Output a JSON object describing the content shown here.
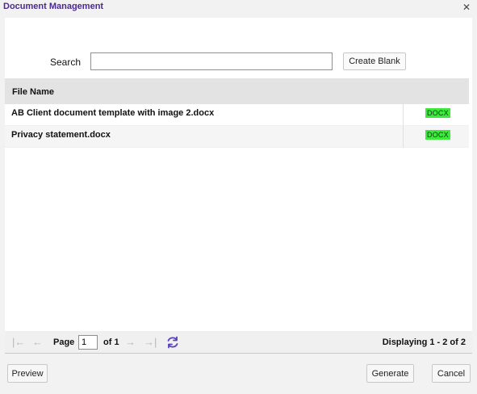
{
  "window": {
    "title": "Document Management",
    "close_glyph": "✕"
  },
  "search": {
    "label": "Search",
    "value": "",
    "placeholder": ""
  },
  "toolbar": {
    "create_blank_label": "Create Blank"
  },
  "grid": {
    "columns": [
      "File Name",
      ""
    ],
    "rows": [
      {
        "name": "AB Client document template with image 2.docx",
        "type": "DOCX"
      },
      {
        "name": "Privacy statement.docx",
        "type": "DOCX"
      }
    ]
  },
  "pager": {
    "page_label": "Page",
    "current_page": "1",
    "of_label": "of 1",
    "display_info": "Displaying 1 - 2 of 2",
    "icons": [
      "first-page-icon",
      "prev-page-icon",
      "next-page-icon",
      "last-page-icon",
      "refresh-icon"
    ]
  },
  "buttons": {
    "preview": "Preview",
    "generate": "Generate",
    "cancel": "Cancel"
  },
  "colors": {
    "title": "#4a2a8c",
    "docx_badge": "#3cea3c",
    "refresh_icon": "#5a3fc0"
  }
}
